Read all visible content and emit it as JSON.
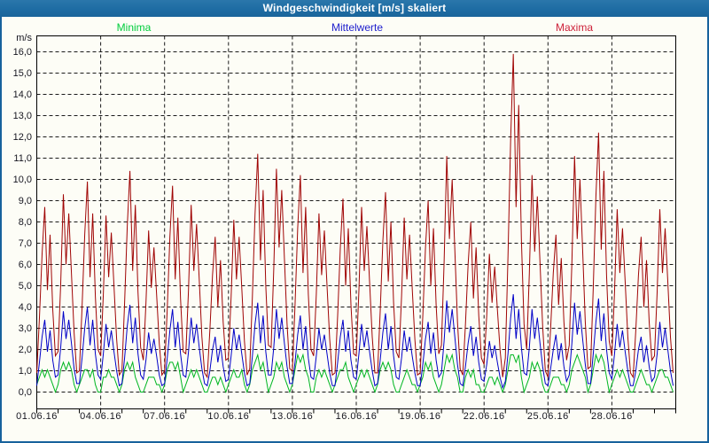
{
  "window": {
    "title": "Windgeschwindigkeit [m/s] skaliert"
  },
  "legend": [
    {
      "label": "Minima",
      "color": "#00cd3c"
    },
    {
      "label": "Mittelwerte",
      "color": "#2121cd"
    },
    {
      "label": "Maxima",
      "color": "#cd2139"
    }
  ],
  "colors": {
    "titlebar_bg": "#1e6ca3",
    "window_border": "#17629c",
    "background": "#fdfdf6",
    "grid": "#1a1a1a",
    "frame": "#000000",
    "tick_text": "#15151f"
  },
  "chart_data": {
    "type": "line",
    "title": "Windgeschwindigkeit [m/s] skaliert",
    "xlabel": "",
    "ylabel": "m/s",
    "ylim": [
      0,
      16
    ],
    "ytick_step": 1.0,
    "ytick_labels": [
      "16,0",
      "15,0",
      "14,0",
      "13,0",
      "12,0",
      "11,0",
      "10,0",
      "9,0",
      "8,0",
      "7,0",
      "6,0",
      "5,0",
      "4,0",
      "3,0",
      "2,0",
      "1,0",
      "0,0"
    ],
    "x_days": 30,
    "samples_per_day": 8,
    "x_grid_every_days": 3,
    "x_minor_tick_every_days": 1,
    "xtick_labels": [
      "01.06.16",
      "04.06.16",
      "07.06.16",
      "10.06.16",
      "13.06.16",
      "16.06.16",
      "19.06.16",
      "22.06.16",
      "25.06.16",
      "28.06.16"
    ],
    "xtick_day_offsets": [
      0,
      3,
      6,
      9,
      12,
      15,
      18,
      21,
      24,
      27
    ],
    "grid": "dashed",
    "legend_position": "top",
    "series": [
      {
        "name": "Minima",
        "color": "#00b622",
        "values": [
          [
            0.35,
            0.7,
            1.05,
            0.7,
            1.05,
            0.7,
            0.35,
            0
          ],
          [
            0.35,
            1.05,
            1.4,
            1.05,
            1.4,
            1.05,
            0.35,
            0
          ],
          [
            0.35,
            0.7,
            1.05,
            1.05,
            0.7,
            1.05,
            0.35,
            0
          ],
          [
            0,
            0.7,
            0.7,
            1.05,
            0.7,
            0.7,
            0.35,
            0
          ],
          [
            0.35,
            1.05,
            1.4,
            1.05,
            1.4,
            0.7,
            0.35,
            0
          ],
          [
            0,
            0.35,
            0.7,
            0.7,
            0.7,
            0.35,
            0.35,
            0
          ],
          [
            0.35,
            1.05,
            1.4,
            1.4,
            1.05,
            1.4,
            0.7,
            0
          ],
          [
            0.35,
            0.7,
            1.05,
            0.7,
            1.05,
            0.7,
            0.35,
            0
          ],
          [
            0,
            0.35,
            0.7,
            0.7,
            0.35,
            0.7,
            0.35,
            0
          ],
          [
            0.35,
            0.7,
            1.05,
            0.7,
            0.7,
            1.05,
            0.35,
            0
          ],
          [
            0.35,
            1.05,
            1.4,
            1.75,
            1.05,
            1.4,
            0.7,
            0
          ],
          [
            0.35,
            0.7,
            1.4,
            1.05,
            1.4,
            0.7,
            0.35,
            0
          ],
          [
            0.35,
            1.05,
            1.75,
            1.4,
            1.75,
            1.05,
            0.7,
            0
          ],
          [
            0,
            0.7,
            1.05,
            0.7,
            1.05,
            0.7,
            0.35,
            0
          ],
          [
            0.35,
            0.7,
            1.05,
            1.05,
            1.4,
            0.7,
            0.35,
            0
          ],
          [
            0.35,
            0.7,
            1.05,
            0.7,
            1.05,
            0.7,
            0.35,
            0
          ],
          [
            0.35,
            1.05,
            1.4,
            1.05,
            1.4,
            1.05,
            0.35,
            0
          ],
          [
            0,
            0.35,
            0.7,
            1.05,
            0.7,
            0.35,
            0.35,
            0
          ],
          [
            0.35,
            0.7,
            1.4,
            1.05,
            1.4,
            0.7,
            0.35,
            0
          ],
          [
            0.35,
            1.05,
            1.75,
            1.4,
            1.75,
            1.05,
            0.7,
            0
          ],
          [
            0,
            0.7,
            1.05,
            0.7,
            1.05,
            0.35,
            0.35,
            0
          ],
          [
            0,
            0.35,
            0.7,
            0.7,
            0.35,
            0.7,
            0.35,
            0
          ],
          [
            0.35,
            1.05,
            1.75,
            1.75,
            1.4,
            1.75,
            0.7,
            0
          ],
          [
            0.35,
            0.7,
            1.4,
            1.05,
            1.4,
            1.05,
            0.35,
            0
          ],
          [
            0,
            0.35,
            0.7,
            0.7,
            0.7,
            0.35,
            0.35,
            0
          ],
          [
            0.35,
            1.05,
            1.4,
            1.75,
            1.4,
            1.05,
            0.7,
            0
          ],
          [
            0.35,
            1.05,
            1.75,
            1.4,
            1.75,
            1.4,
            0.7,
            0
          ],
          [
            0.35,
            0.7,
            1.05,
            0.7,
            1.05,
            0.7,
            0.35,
            0
          ],
          [
            0,
            0.35,
            0.7,
            1.05,
            0.7,
            0.35,
            0.35,
            0
          ],
          [
            0.35,
            0.7,
            1.05,
            1.05,
            0.7,
            0.7,
            0.35,
            0
          ]
        ]
      },
      {
        "name": "Mittelwerte",
        "color": "#0000c8",
        "values": [
          [
            0.3,
            1.4,
            2.6,
            3.4,
            1.9,
            2.9,
            1.5,
            0.7
          ],
          [
            0.8,
            2.1,
            3.8,
            2.5,
            3.4,
            2.3,
            1.1,
            0.4
          ],
          [
            0.4,
            1.6,
            3.0,
            4.0,
            2.2,
            3.4,
            1.8,
            0.8
          ],
          [
            0.6,
            1.8,
            3.2,
            2.1,
            2.9,
            1.9,
            1.0,
            0.3
          ],
          [
            0.4,
            1.6,
            3.1,
            4.1,
            2.3,
            3.5,
            1.8,
            0.8
          ],
          [
            0.6,
            1.5,
            2.8,
            1.8,
            2.5,
            1.7,
            0.8,
            0.3
          ],
          [
            0.4,
            1.6,
            2.9,
            3.9,
            2.1,
            3.3,
            1.8,
            0.8
          ],
          [
            0.7,
            1.9,
            3.5,
            2.3,
            3.2,
            2.1,
            1.1,
            0.4
          ],
          [
            0.3,
            1.0,
            2.0,
            2.6,
            1.4,
            2.2,
            1.2,
            0.5
          ],
          [
            0.6,
            1.7,
            3.0,
            2.0,
            2.7,
            1.8,
            0.9,
            0.3
          ],
          [
            0.4,
            1.7,
            3.2,
            4.2,
            2.3,
            3.6,
            1.9,
            0.8
          ],
          [
            0.8,
            2.1,
            3.9,
            2.5,
            3.5,
            2.3,
            1.2,
            0.4
          ],
          [
            0.4,
            1.4,
            2.7,
            3.6,
            2.0,
            3.1,
            1.6,
            0.7
          ],
          [
            0.6,
            1.7,
            3.0,
            2.0,
            2.7,
            1.8,
            0.9,
            0.3
          ],
          [
            0.3,
            1.4,
            2.6,
            3.4,
            1.9,
            2.9,
            1.5,
            0.7
          ],
          [
            0.6,
            1.8,
            3.2,
            2.1,
            2.9,
            1.9,
            1.0,
            0.3
          ],
          [
            0.4,
            1.5,
            2.8,
            3.7,
            2.0,
            3.1,
            1.7,
            0.7
          ],
          [
            0.6,
            1.6,
            2.9,
            1.9,
            2.6,
            1.7,
            0.9,
            0.3
          ],
          [
            0.3,
            1.3,
            2.5,
            3.3,
            1.8,
            2.8,
            1.5,
            0.7
          ],
          [
            0.9,
            2.4,
            4.3,
            2.8,
            3.9,
            2.6,
            1.3,
            0.4
          ],
          [
            0.3,
            1.2,
            2.3,
            3.1,
            1.7,
            2.6,
            1.4,
            0.6
          ],
          [
            0.5,
            1.3,
            2.4,
            1.6,
            2.2,
            1.4,
            0.7,
            0.2
          ],
          [
            0.5,
            1.8,
            3.5,
            4.6,
            2.5,
            3.9,
            2.1,
            0.9
          ],
          [
            0.8,
            2.1,
            3.9,
            2.5,
            3.5,
            2.3,
            1.2,
            0.4
          ],
          [
            0.3,
            1.1,
            2.0,
            2.7,
            1.5,
            2.3,
            1.2,
            0.5
          ],
          [
            0.8,
            2.3,
            4.2,
            2.7,
            3.8,
            2.5,
            1.3,
            0.4
          ],
          [
            0.4,
            1.8,
            3.3,
            4.4,
            2.4,
            3.7,
            2.0,
            0.9
          ],
          [
            0.6,
            1.8,
            3.2,
            2.1,
            2.9,
            1.9,
            1.0,
            0.3
          ],
          [
            0.3,
            1.0,
            2.0,
            2.6,
            1.4,
            2.2,
            1.2,
            0.5
          ],
          [
            0.7,
            1.8,
            3.3,
            2.1,
            3.0,
            2.0,
            1.0,
            0.3
          ]
        ]
      },
      {
        "name": "Maxima",
        "color": "#a00505",
        "values": [
          [
            0.9,
            3.5,
            6.5,
            8.7,
            4.8,
            7.4,
            3.9,
            1.7
          ],
          [
            1.9,
            5.1,
            9.3,
            6.0,
            8.4,
            5.6,
            2.8,
            0.9
          ],
          [
            1.0,
            4.0,
            7.4,
            9.9,
            5.4,
            8.4,
            4.5,
            2.0
          ],
          [
            1.7,
            4.6,
            8.3,
            5.4,
            7.5,
            5.0,
            2.5,
            0.8
          ],
          [
            1.0,
            4.2,
            7.8,
            10.4,
            5.7,
            8.8,
            4.7,
            2.1
          ],
          [
            1.5,
            4.2,
            7.6,
            4.9,
            6.8,
            4.6,
            2.3,
            0.8
          ],
          [
            1.0,
            3.9,
            7.3,
            9.7,
            5.3,
            8.2,
            4.4,
            1.9
          ],
          [
            1.8,
            4.8,
            8.8,
            5.7,
            7.9,
            5.3,
            2.6,
            0.9
          ],
          [
            0.7,
            2.9,
            5.5,
            7.3,
            4.0,
            6.2,
            3.3,
            1.5
          ],
          [
            1.6,
            4.5,
            8.1,
            5.3,
            7.3,
            4.9,
            2.4,
            0.8
          ],
          [
            1.1,
            4.5,
            8.4,
            11.2,
            6.2,
            9.5,
            5.0,
            2.2
          ],
          [
            2.1,
            5.8,
            10.5,
            6.8,
            9.5,
            6.3,
            3.2,
            1.1
          ],
          [
            1.0,
            4.1,
            7.7,
            10.2,
            5.6,
            8.7,
            4.6,
            2.0
          ],
          [
            1.7,
            4.6,
            8.4,
            5.5,
            7.6,
            5.0,
            2.5,
            0.8
          ],
          [
            0.9,
            3.6,
            6.8,
            9.1,
            5.0,
            7.7,
            4.1,
            1.8
          ],
          [
            1.7,
            4.8,
            8.7,
            5.7,
            7.8,
            5.2,
            2.6,
            0.9
          ],
          [
            0.9,
            3.8,
            7.1,
            9.4,
            5.2,
            8.0,
            4.2,
            1.9
          ],
          [
            1.6,
            4.5,
            8.2,
            5.3,
            7.4,
            4.9,
            2.5,
            0.8
          ],
          [
            0.9,
            3.6,
            6.8,
            9.0,
            5.0,
            7.7,
            4.1,
            1.8
          ],
          [
            2.2,
            6.1,
            11.1,
            7.2,
            10.0,
            6.7,
            3.3,
            1.1
          ],
          [
            0.8,
            3.2,
            6.0,
            8.0,
            4.4,
            6.8,
            3.6,
            1.6
          ],
          [
            1.3,
            3.6,
            6.5,
            4.2,
            5.9,
            3.9,
            2.0,
            0.7
          ],
          [
            1.6,
            6.4,
            11.9,
            15.9,
            8.7,
            13.5,
            7.2,
            3.2
          ],
          [
            2.0,
            5.6,
            10.2,
            6.6,
            9.2,
            6.1,
            3.1,
            1.0
          ],
          [
            0.7,
            3.0,
            5.6,
            7.4,
            4.1,
            6.3,
            3.3,
            1.5
          ],
          [
            2.2,
            6.1,
            11.1,
            7.2,
            10.0,
            6.7,
            3.3,
            1.1
          ],
          [
            1.2,
            4.9,
            9.2,
            12.2,
            6.7,
            10.4,
            5.5,
            2.4
          ],
          [
            1.7,
            4.7,
            8.6,
            5.6,
            7.7,
            5.2,
            2.6,
            0.9
          ],
          [
            0.7,
            2.9,
            5.5,
            7.3,
            4.0,
            6.2,
            3.3,
            1.5
          ],
          [
            1.7,
            4.7,
            8.6,
            5.6,
            7.7,
            5.2,
            2.6,
            0.9
          ]
        ]
      }
    ]
  }
}
